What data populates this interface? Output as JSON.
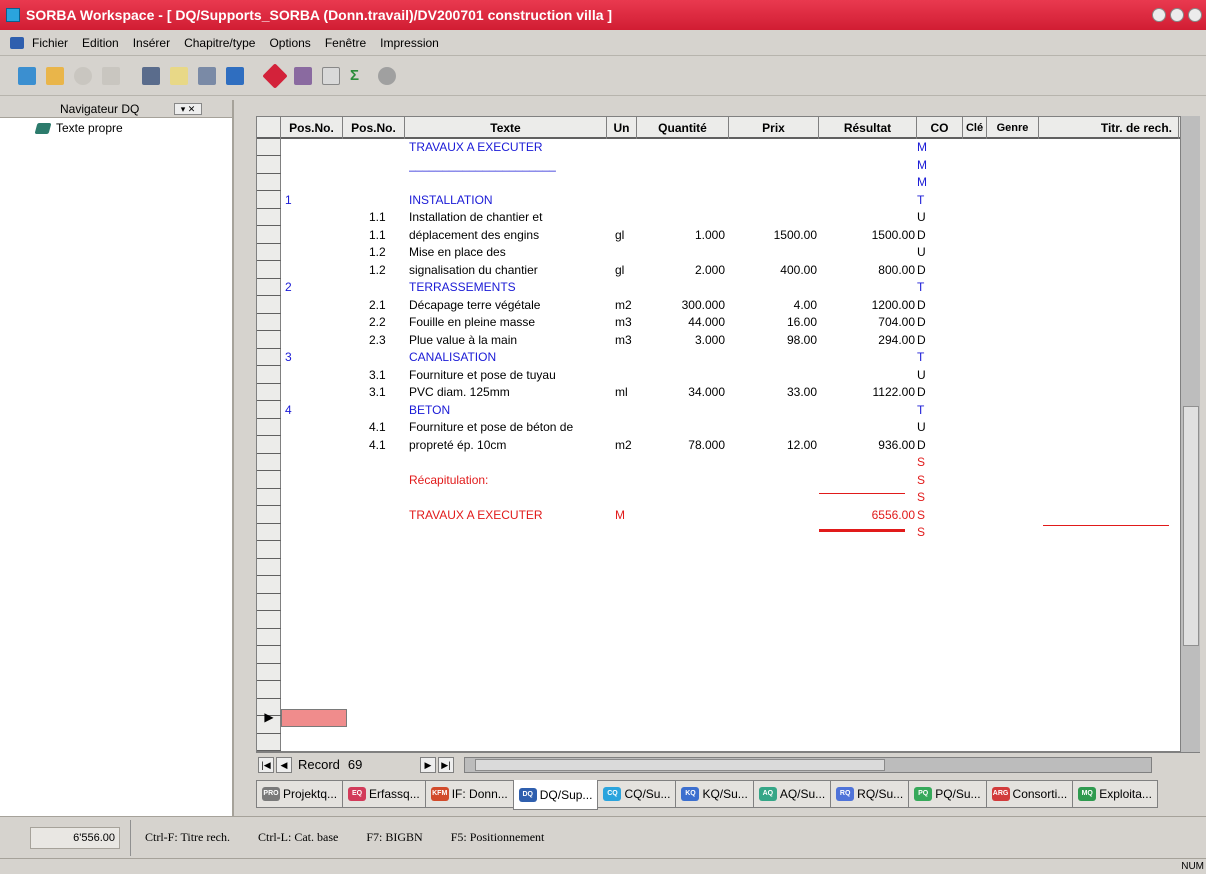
{
  "window": {
    "title": "SORBA Workspace - [ DQ/Supports_SORBA (Donn.travail)/DV200701 construction villa               ]"
  },
  "menu": [
    "Fichier",
    "Edition",
    "Insérer",
    "Chapitre/type",
    "Options",
    "Fenêtre",
    "Impression"
  ],
  "navigator": {
    "title": "Navigateur DQ",
    "item": "Texte propre"
  },
  "columns": [
    "Pos.No.",
    "Pos.No.",
    "Texte",
    "Un",
    "Quantité",
    "Prix",
    "Résultat",
    "CO",
    "Clé",
    "Genre",
    "Titr. de rech."
  ],
  "rows": [
    {
      "p1": "",
      "p2": "",
      "text": "TRAVAUX A EXECUTER",
      "un": "",
      "qty": "",
      "prix": "",
      "res": "",
      "co": "M",
      "style": "blue"
    },
    {
      "p1": "",
      "p2": "",
      "text": "______________________",
      "un": "",
      "qty": "",
      "prix": "",
      "res": "",
      "co": "M",
      "style": "blue"
    },
    {
      "p1": "",
      "p2": "",
      "text": "",
      "un": "",
      "qty": "",
      "prix": "",
      "res": "",
      "co": "M",
      "style": "blue"
    },
    {
      "p1": "1",
      "p2": "",
      "text": "INSTALLATION",
      "un": "",
      "qty": "",
      "prix": "",
      "res": "",
      "co": "T",
      "style": "blue"
    },
    {
      "p1": "",
      "p2": "1.1",
      "text": "Installation de chantier et",
      "un": "",
      "qty": "",
      "prix": "",
      "res": "",
      "co": "U",
      "style": ""
    },
    {
      "p1": "",
      "p2": "1.1",
      "text": "déplacement des engins",
      "un": "gl",
      "qty": "1.000",
      "prix": "1500.00",
      "res": "1500.00",
      "co": "D",
      "style": ""
    },
    {
      "p1": "",
      "p2": "1.2",
      "text": "Mise en place des",
      "un": "",
      "qty": "",
      "prix": "",
      "res": "",
      "co": "U",
      "style": ""
    },
    {
      "p1": "",
      "p2": "1.2",
      "text": "signalisation du chantier",
      "un": "gl",
      "qty": "2.000",
      "prix": "400.00",
      "res": "800.00",
      "co": "D",
      "style": ""
    },
    {
      "p1": "2",
      "p2": "",
      "text": "TERRASSEMENTS",
      "un": "",
      "qty": "",
      "prix": "",
      "res": "",
      "co": "T",
      "style": "blue"
    },
    {
      "p1": "",
      "p2": "2.1",
      "text": "Décapage terre végétale",
      "un": "m2",
      "qty": "300.000",
      "prix": "4.00",
      "res": "1200.00",
      "co": "D",
      "style": ""
    },
    {
      "p1": "",
      "p2": "2.2",
      "text": "Fouille en pleine masse",
      "un": "m3",
      "qty": "44.000",
      "prix": "16.00",
      "res": "704.00",
      "co": "D",
      "style": ""
    },
    {
      "p1": "",
      "p2": "2.3",
      "text": "Plue value à la main",
      "un": "m3",
      "qty": "3.000",
      "prix": "98.00",
      "res": "294.00",
      "co": "D",
      "style": ""
    },
    {
      "p1": "3",
      "p2": "",
      "text": "CANALISATION",
      "un": "",
      "qty": "",
      "prix": "",
      "res": "",
      "co": "T",
      "style": "blue"
    },
    {
      "p1": "",
      "p2": "3.1",
      "text": "Fourniture et pose de tuyau",
      "un": "",
      "qty": "",
      "prix": "",
      "res": "",
      "co": "U",
      "style": ""
    },
    {
      "p1": "",
      "p2": "3.1",
      "text": "PVC diam. 125mm",
      "un": "ml",
      "qty": "34.000",
      "prix": "33.00",
      "res": "1122.00",
      "co": "D",
      "style": ""
    },
    {
      "p1": "4",
      "p2": "",
      "text": "BETON",
      "un": "",
      "qty": "",
      "prix": "",
      "res": "",
      "co": "T",
      "style": "blue"
    },
    {
      "p1": "",
      "p2": "4.1",
      "text": "Fourniture et pose de béton de",
      "un": "",
      "qty": "",
      "prix": "",
      "res": "",
      "co": "U",
      "style": ""
    },
    {
      "p1": "",
      "p2": "4.1",
      "text": "propreté ép. 10cm",
      "un": "m2",
      "qty": "78.000",
      "prix": "12.00",
      "res": "936.00",
      "co": "D",
      "style": ""
    },
    {
      "p1": "",
      "p2": "",
      "text": "",
      "un": "",
      "qty": "",
      "prix": "",
      "res": "",
      "co": "S",
      "style": "red"
    },
    {
      "p1": "",
      "p2": "",
      "text": "Récapitulation:",
      "un": "",
      "qty": "",
      "prix": "",
      "res": "",
      "co": "S",
      "style": "red"
    },
    {
      "p1": "",
      "p2": "",
      "text": "",
      "un": "",
      "qty": "",
      "prix": "",
      "res": "",
      "co": "S",
      "style": "red"
    },
    {
      "p1": "",
      "p2": "",
      "text": "TRAVAUX A EXECUTER",
      "un": "M",
      "qty": "",
      "prix": "",
      "res": "6556.00",
      "co": "S",
      "style": "red"
    },
    {
      "p1": "",
      "p2": "",
      "text": "",
      "un": "",
      "qty": "",
      "prix": "",
      "res": "",
      "co": "S",
      "style": "red"
    }
  ],
  "record": {
    "label": "Record",
    "number": "69"
  },
  "tabs": [
    {
      "icon": "PRO",
      "label": "Projektq...",
      "color": "#7a7a7a"
    },
    {
      "icon": "EQ",
      "label": "Erfassq...",
      "color": "#d23b5a"
    },
    {
      "icon": "KFM",
      "label": "IF: Donn...",
      "color": "#d24b2b"
    },
    {
      "icon": "DQ",
      "label": "DQ/Sup...",
      "color": "#2f5fae"
    },
    {
      "icon": "CQ",
      "label": "CQ/Su...",
      "color": "#2aa4dd"
    },
    {
      "icon": "KQ",
      "label": "KQ/Su...",
      "color": "#3c6fcf"
    },
    {
      "icon": "AQ",
      "label": "AQ/Su...",
      "color": "#35a687"
    },
    {
      "icon": "RQ",
      "label": "RQ/Su...",
      "color": "#4f73d9"
    },
    {
      "icon": "PQ",
      "label": "PQ/Su...",
      "color": "#36a95a"
    },
    {
      "icon": "ARG",
      "label": "Consorti...",
      "color": "#d23b3b"
    },
    {
      "icon": "MQ",
      "label": "Exploita...",
      "color": "#2f9a4f"
    }
  ],
  "status": {
    "total": "6'556.00",
    "hints": [
      "Ctrl-F: Titre rech.",
      "Ctrl-L: Cat. base",
      "F7: BIGBN",
      "F5: Positionnement"
    ],
    "num": "NUM"
  }
}
